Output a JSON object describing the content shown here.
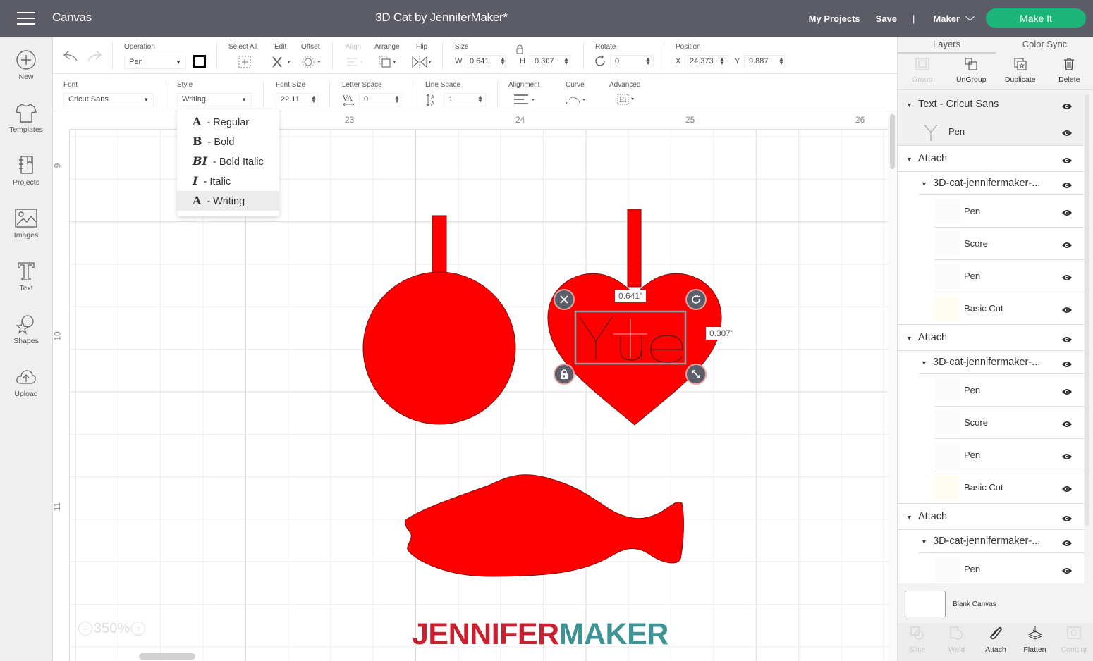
{
  "topbar": {
    "app_title": "Canvas",
    "doc_title": "3D Cat by JenniferMaker*",
    "my_projects": "My Projects",
    "save": "Save",
    "separator": "|",
    "machine": "Maker",
    "make_it": "Make It",
    "accent_color": "#1bb57a"
  },
  "leftbar": {
    "items": [
      {
        "label": "New",
        "icon": "plus-circle-icon"
      },
      {
        "label": "Templates",
        "icon": "tshirt-icon"
      },
      {
        "label": "Projects",
        "icon": "notebook-icon"
      },
      {
        "label": "Images",
        "icon": "image-icon"
      },
      {
        "label": "Text",
        "icon": "text-t-icon"
      },
      {
        "label": "Shapes",
        "icon": "shapes-icon"
      },
      {
        "label": "Upload",
        "icon": "cloud-upload-icon"
      }
    ]
  },
  "toolbar": {
    "operation_label": "Operation",
    "operation_value": "Pen",
    "select_all": "Select All",
    "edit": "Edit",
    "offset": "Offset",
    "align": "Align",
    "arrange": "Arrange",
    "flip": "Flip",
    "size_label": "Size",
    "w_prefix": "W",
    "w_value": "0.641",
    "h_prefix": "H",
    "h_value": "0.307",
    "rotate_label": "Rotate",
    "rotate_value": "0",
    "position_label": "Position",
    "x_prefix": "X",
    "x_value": "24.373",
    "y_prefix": "Y",
    "y_value": "9.887"
  },
  "textbar": {
    "font_label": "Font",
    "font_value": "Cricut Sans",
    "style_label": "Style",
    "style_value": "Writing",
    "font_size_label": "Font Size",
    "font_size_value": "22.11",
    "letter_space_label": "Letter Space",
    "letter_space_value": "0",
    "line_space_label": "Line Space",
    "line_space_value": "1",
    "alignment_label": "Alignment",
    "curve_label": "Curve",
    "advanced_label": "Advanced"
  },
  "style_menu": {
    "items": [
      {
        "glyph": "A",
        "label": " - Regular",
        "active": false
      },
      {
        "glyph": "B",
        "label": " - Bold",
        "active": false
      },
      {
        "glyph": "BI",
        "label": " - Bold Italic",
        "active": false
      },
      {
        "glyph": "I",
        "label": " - Italic",
        "active": false
      },
      {
        "glyph": "A",
        "label": " - Writing",
        "active": true
      }
    ]
  },
  "canvas": {
    "ruler_top": [
      "23",
      "24",
      "25",
      "26"
    ],
    "ruler_left": [
      "9",
      "10",
      "11"
    ],
    "zoom_level": "350%",
    "width_readout": "0.641\"",
    "height_readout": "0.307\"",
    "text_content": "Yue",
    "shape_color": "#ff0000",
    "watermark_a": "JENNIFER",
    "watermark_b": "MAKER"
  },
  "rightpanel": {
    "tabs": [
      {
        "label": "Layers",
        "active": true
      },
      {
        "label": "Color Sync",
        "active": false
      }
    ],
    "actions": [
      {
        "label": "Group",
        "enabled": false
      },
      {
        "label": "UnGroup",
        "enabled": true
      },
      {
        "label": "Duplicate",
        "enabled": true
      },
      {
        "label": "Delete",
        "enabled": true
      }
    ],
    "layers": [
      {
        "label": "Text - Cricut Sans",
        "level": 0
      },
      {
        "label": "Pen",
        "level": 2
      },
      {
        "label": "Attach",
        "level": 0
      },
      {
        "label": "3D-cat-jennifermaker-...",
        "level": 1
      },
      {
        "label": "Pen",
        "level": 2
      },
      {
        "label": "Score",
        "level": 2
      },
      {
        "label": "Pen",
        "level": 2
      },
      {
        "label": "Basic Cut",
        "level": 2
      },
      {
        "label": "Attach",
        "level": 0
      },
      {
        "label": "3D-cat-jennifermaker-...",
        "level": 1
      },
      {
        "label": "Pen",
        "level": 2
      },
      {
        "label": "Score",
        "level": 2
      },
      {
        "label": "Pen",
        "level": 2
      },
      {
        "label": "Basic Cut",
        "level": 2
      },
      {
        "label": "Attach",
        "level": 0
      },
      {
        "label": "3D-cat-jennifermaker-...",
        "level": 1
      },
      {
        "label": "Pen",
        "level": 2
      }
    ],
    "blank_canvas": "Blank Canvas",
    "bottom_actions": [
      {
        "label": "Slice",
        "enabled": false
      },
      {
        "label": "Weld",
        "enabled": false
      },
      {
        "label": "Attach",
        "enabled": true
      },
      {
        "label": "Flatten",
        "enabled": true
      },
      {
        "label": "Contour",
        "enabled": false
      }
    ]
  }
}
